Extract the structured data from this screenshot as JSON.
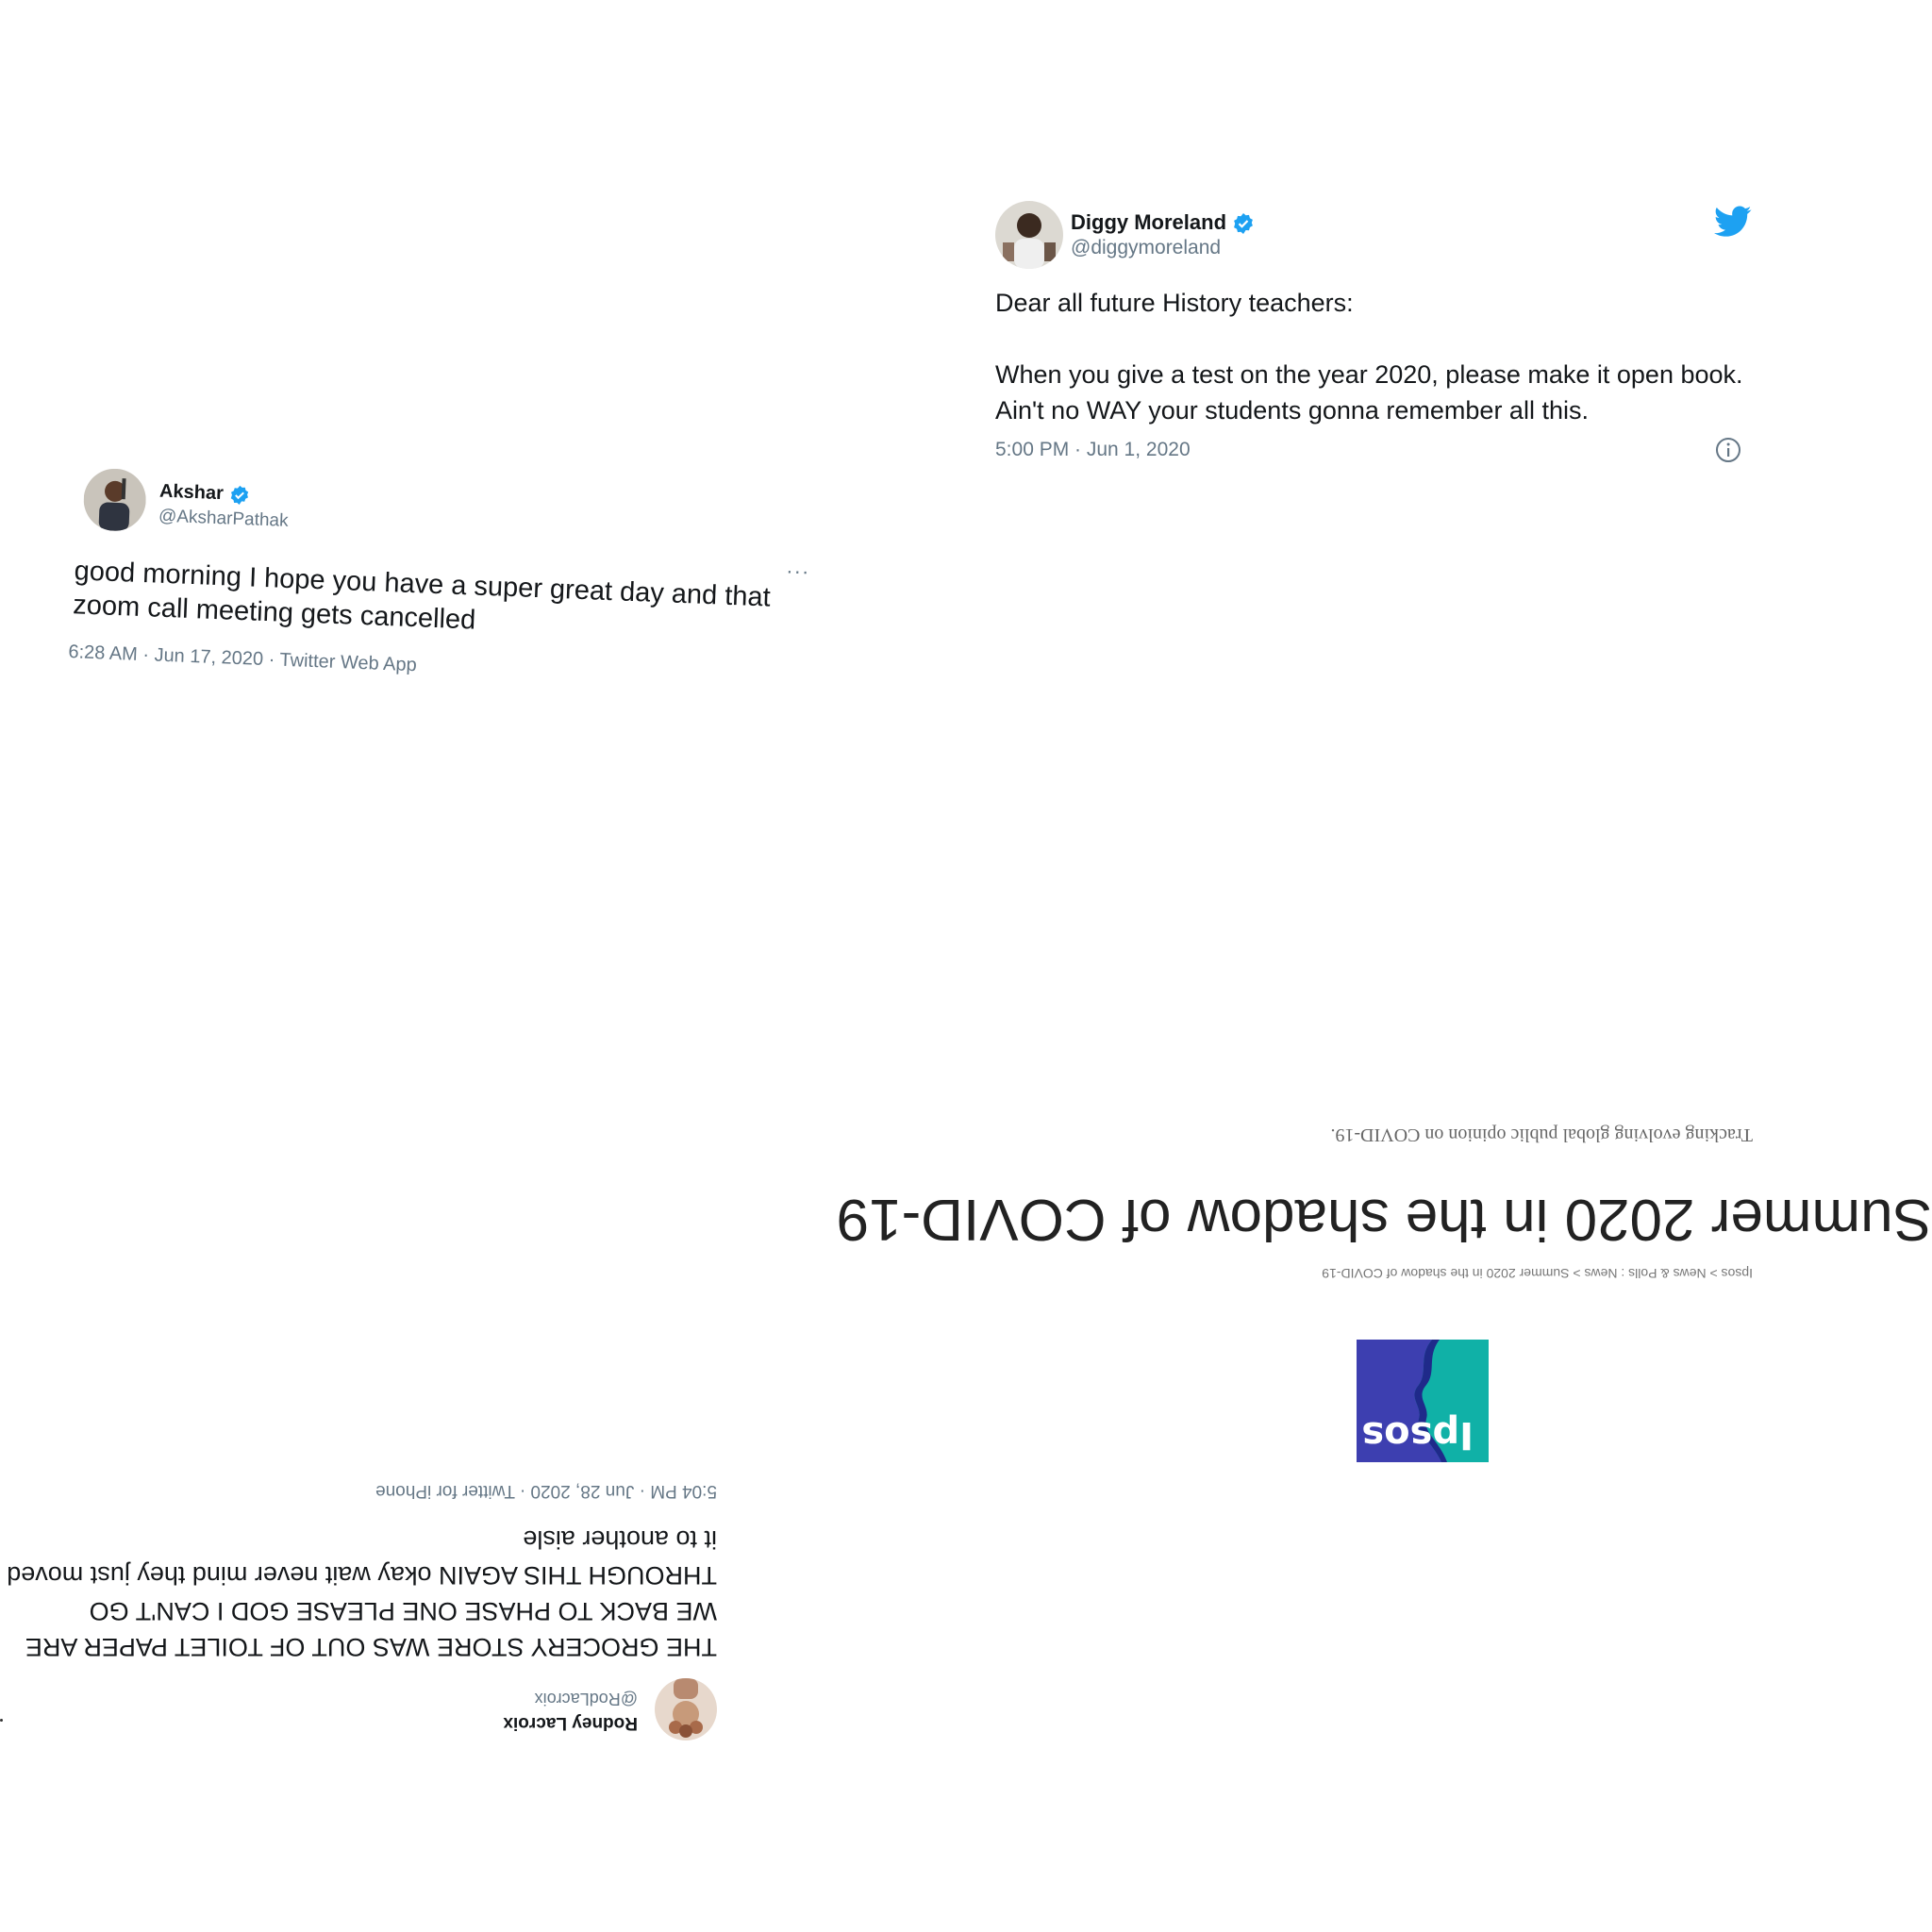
{
  "tweets": {
    "diggy": {
      "name": "Diggy Moreland",
      "handle": "@diggymoreland",
      "text": "Dear all future History teachers:\n\nWhen you give a test on the year 2020, please make it open book. Ain't no WAY your students gonna remember all this.",
      "meta": "5:00 PM · Jun 1, 2020",
      "icons": [
        "verified-badge",
        "twitter-bird",
        "info"
      ]
    },
    "akshar": {
      "name": "Akshar",
      "handle": "@AksharPathak",
      "text": "good morning I hope you have a super great day and that zoom call meeting gets cancelled",
      "meta": "6:28 AM · Jun 17, 2020 · Twitter Web App",
      "more": "···",
      "icons": [
        "verified-badge",
        "more-options"
      ]
    },
    "rodney": {
      "name": "Rodney Lacroix",
      "handle": "@RodLacroix",
      "text": "THE GROCERY STORE WAS OUT OF TOILET PAPER ARE WE BACK TO PHASE ONE PLEASE GOD I CAN'T GO THROUGH THIS AGAIN okay wait never mind they just moved it to another aisle",
      "meta": "5:04 PM · Jun 28, 2020 · Twitter for iPhone"
    }
  },
  "ipsos": {
    "logo_text": "Ipsos",
    "breadcrumb": "Ipsos > News & Polls : News > Summer 2020 in the shadow of COVID-19",
    "title": "Summer 2020 in the shadow of COVID-19",
    "subtitle": "Tracking evolving global public opinion on COVID-19.",
    "colors": {
      "teal": "#10b1a7",
      "blue": "#3d3fb0",
      "dark_blue": "#1f2a8a"
    }
  },
  "colors": {
    "twitter_blue": "#1da1f2",
    "meta_gray": "#657786",
    "text": "#14171a"
  }
}
